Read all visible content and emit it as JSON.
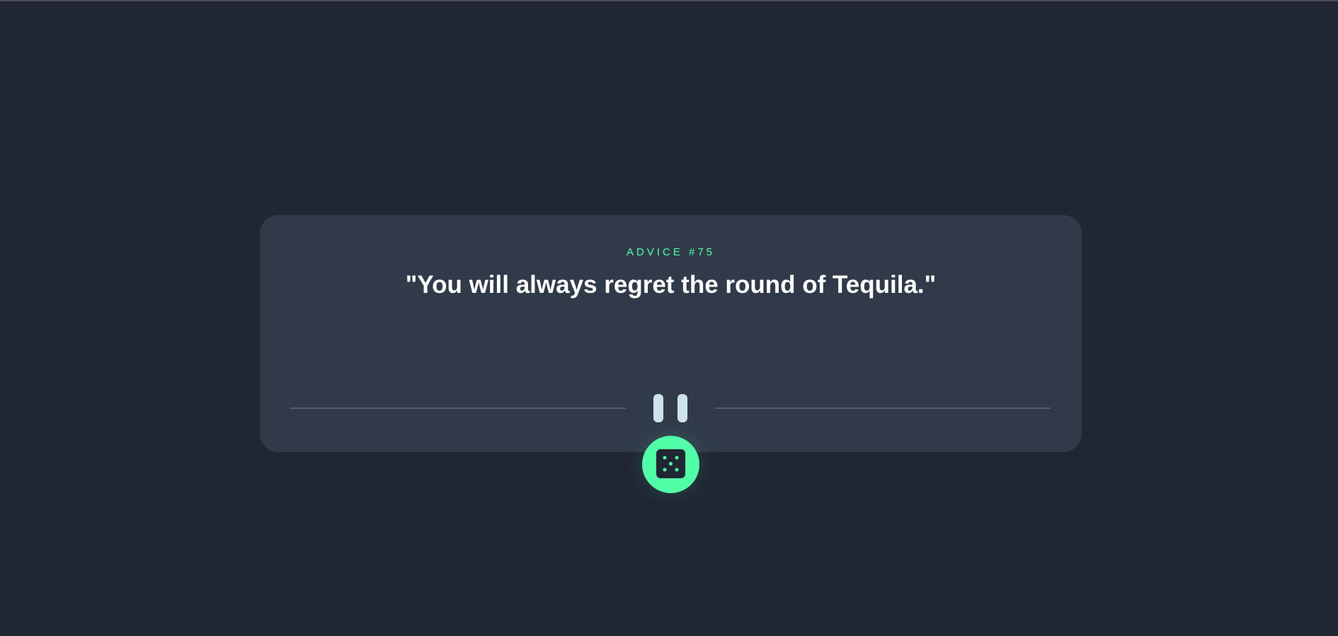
{
  "card": {
    "advice_label": "ADVICE #75",
    "quote": "\"You will always regret the round of Tequila.\""
  },
  "icons": {
    "divider_center": "pause-icon",
    "generate_button": "dice-icon"
  },
  "colors": {
    "background": "#202632",
    "card": "#313a49",
    "accent": "#52ffa8",
    "quote_text": "#ffffff",
    "divider": "#4f5d74",
    "pause_bars": "#cee3e9"
  }
}
